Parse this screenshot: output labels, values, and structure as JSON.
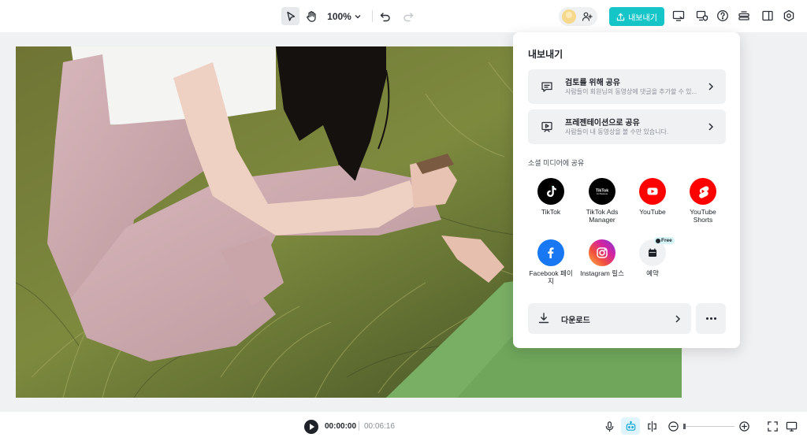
{
  "toolbar": {
    "zoom": "100%",
    "export_label": "내보내기"
  },
  "player": {
    "current_time": "00:00:00",
    "total_time": "00:06:16"
  },
  "export_panel": {
    "title": "내보내기",
    "share_review": {
      "title": "검토를 위해 공유",
      "description": "사람들이 회원님의 동영상에 댓글을 추가할 수 있..."
    },
    "share_presentation": {
      "title": "프레젠테이션으로 공유",
      "description": "사람들이 내 동영상을 볼 수만 있습니다."
    },
    "social_section_label": "소셜 미디어에 공유",
    "social": [
      {
        "label": "TikTok",
        "icon": "tiktok-icon",
        "color": "#000000"
      },
      {
        "label": "TikTok Ads Manager",
        "icon": "tiktok-ads-icon",
        "color": "#000000"
      },
      {
        "label": "YouTube",
        "icon": "youtube-icon",
        "color": "#ff0000"
      },
      {
        "label": "YouTube Shorts",
        "icon": "youtube-shorts-icon",
        "color": "#ff0000"
      },
      {
        "label": "Facebook 페이지",
        "icon": "facebook-icon",
        "color": "#1877f2"
      },
      {
        "label": "Instagram 릴스",
        "icon": "instagram-icon",
        "color": "#d6249f"
      },
      {
        "label": "예약",
        "icon": "calendar-icon",
        "color": "#f0f1f3"
      }
    ],
    "free_badge": "Free",
    "tiktok_ads_logo": {
      "line1": "TikTok",
      "line2": "For Business"
    },
    "download_label": "다운로드"
  },
  "colors": {
    "accent": "#16c5c7",
    "panel_bg": "#ffffff",
    "canvas_bg": "#f0f1f3"
  }
}
